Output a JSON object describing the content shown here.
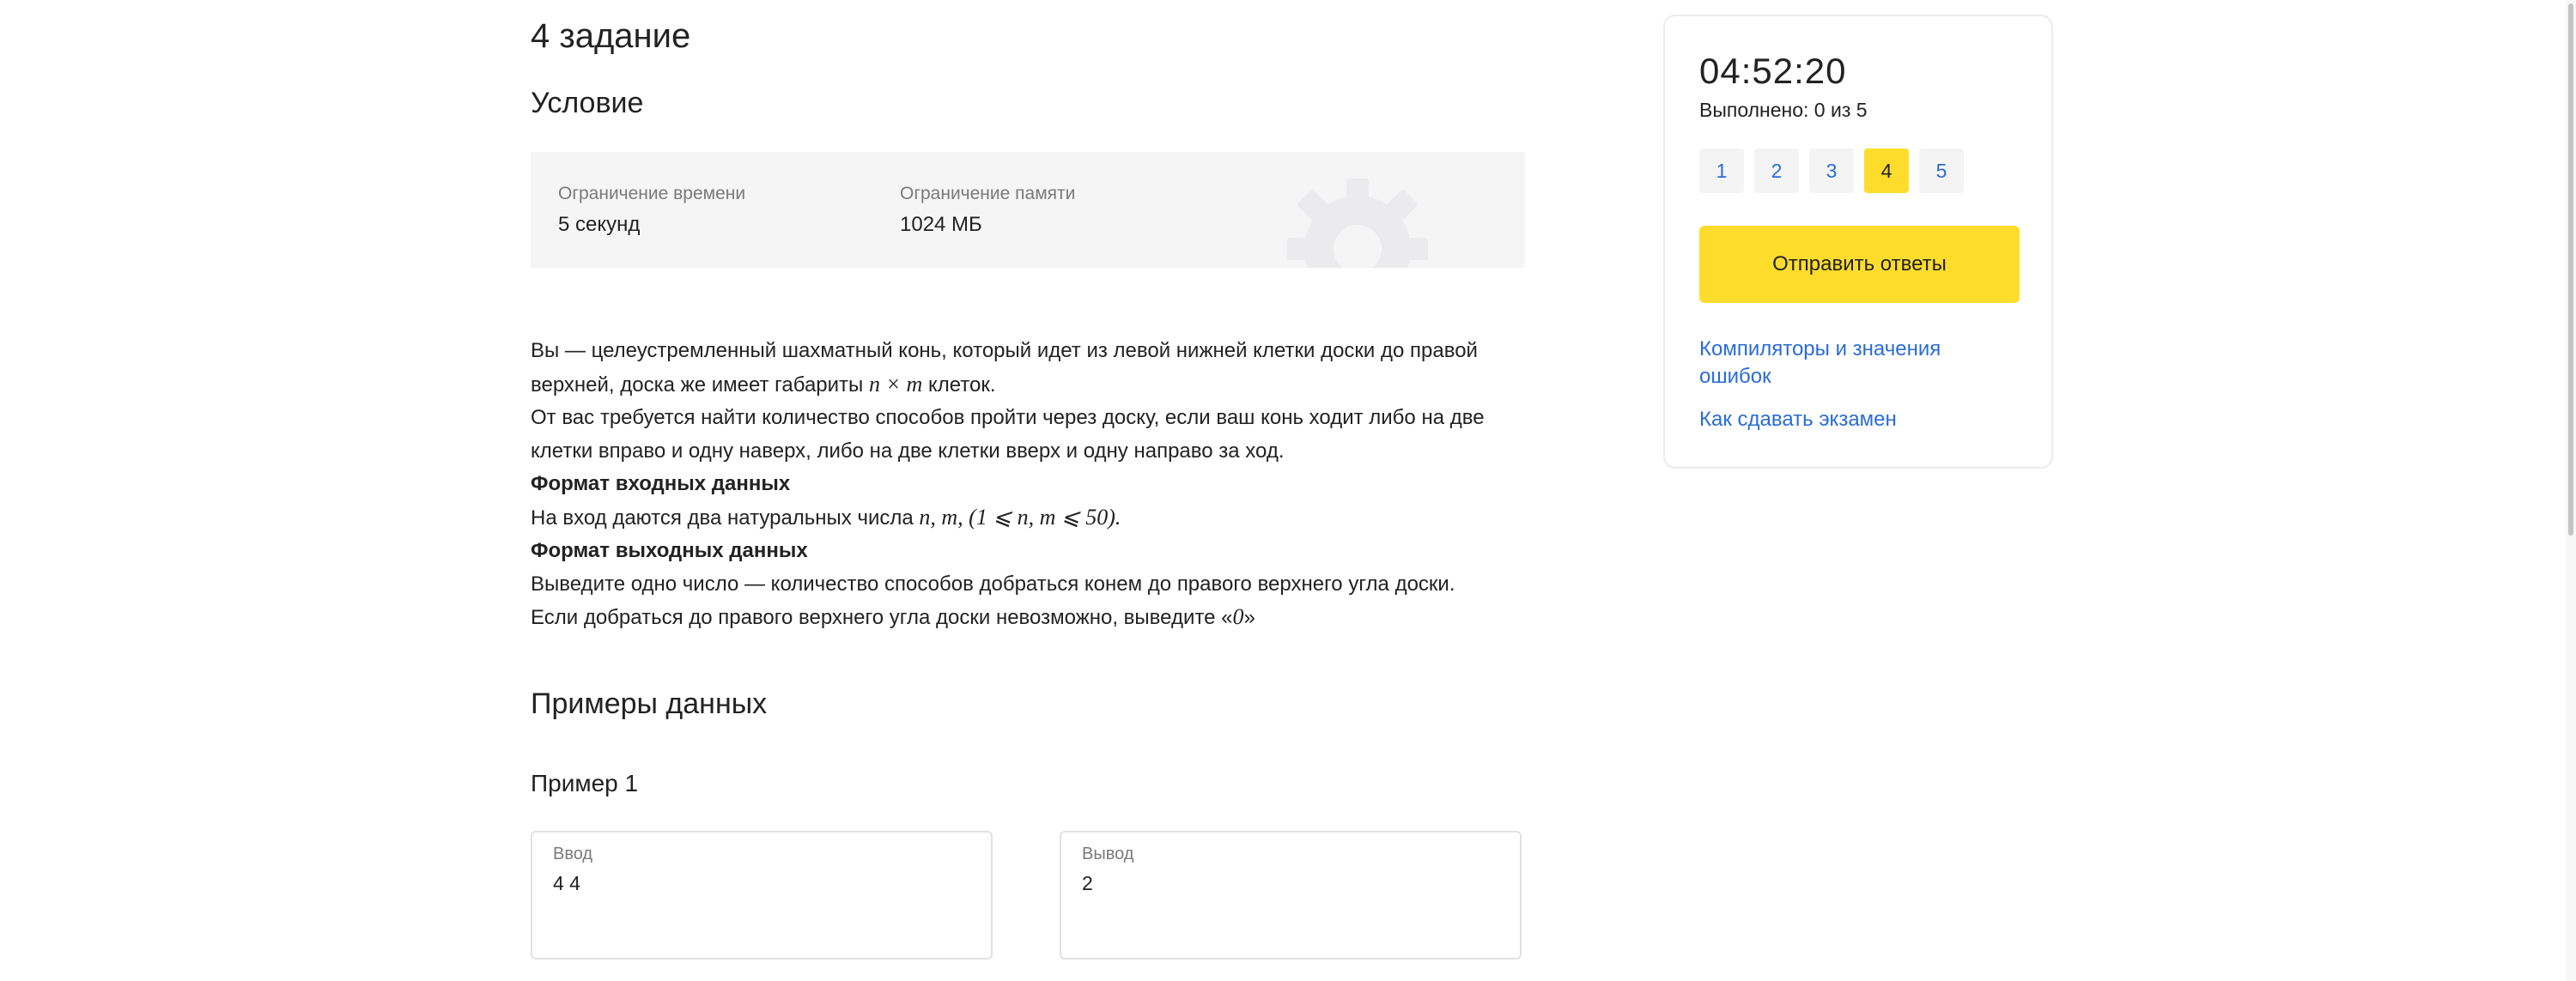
{
  "task": {
    "title": "4 задание",
    "condition_heading": "Условие"
  },
  "limits": {
    "time_label": "Ограничение времени",
    "time_value": "5 секунд",
    "memory_label": "Ограничение памяти",
    "memory_value": "1024 МБ"
  },
  "statement": {
    "line1_before_math": "Вы — целеустремленный шахматный конь, который идет из левой нижней клетки доски до правой верхней, доска же имеет габариты ",
    "line1_math": "n × m",
    "line1_after_math": " клеток.",
    "line2": "От вас требуется найти количество способов пройти через доску, если ваш конь ходит либо на две клетки вправо и одну наверх, либо на две клетки вверх и одну направо за ход.",
    "input_format_heading": "Формат входных данных",
    "input_before_math": "На вход даются два натуральных числа ",
    "input_math": "n, m, (1 ⩽ n, m ⩽ 50).",
    "output_format_heading": "Формат выходных данных",
    "output_line1": "Выведите одно число — количество способов добраться конем до правого верхнего угла доски.",
    "output_line2_before": "Если добраться до правого верхнего угла доски невозможно, выведите «",
    "output_line2_math": "0",
    "output_line2_after": "»"
  },
  "examples": {
    "heading": "Примеры данных",
    "items": [
      {
        "title": "Пример 1",
        "input_label": "Ввод",
        "input_value": "4 4",
        "output_label": "Вывод",
        "output_value": "2"
      }
    ]
  },
  "sidebar": {
    "timer": "04:52:20",
    "progress": "Выполнено: 0 из 5",
    "tasks": [
      "1",
      "2",
      "3",
      "4",
      "5"
    ],
    "active_task": "4",
    "submit_label": "Отправить ответы",
    "link_compilers": "Компиляторы и значения ошибок",
    "link_howto": "Как сдавать экзамен"
  },
  "colors": {
    "accent_yellow": "#fedc2c",
    "link_blue": "#2a6cd6",
    "limits_bg": "#f5f5f6"
  }
}
